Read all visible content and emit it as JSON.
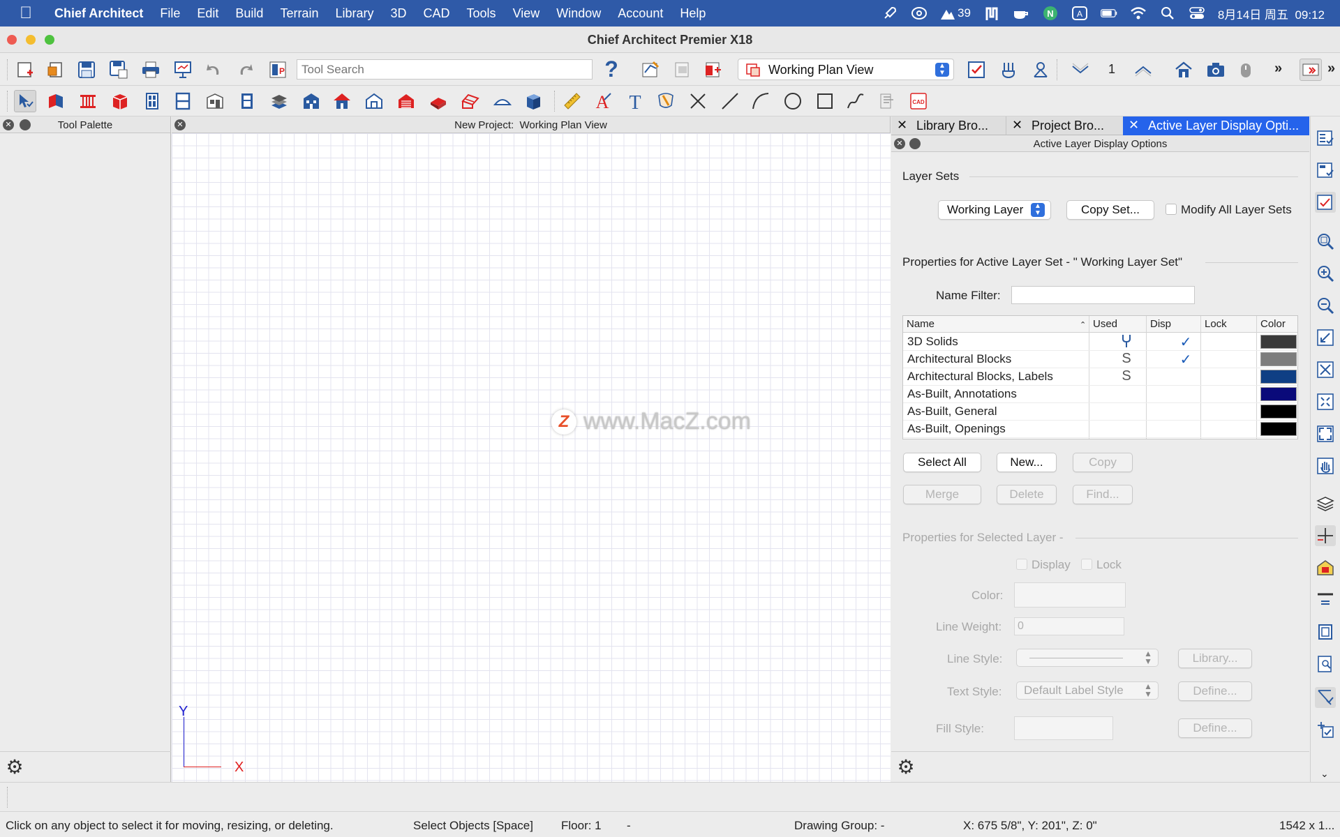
{
  "menubar": {
    "app_name": "Chief Architect",
    "items": [
      "File",
      "Edit",
      "Build",
      "Terrain",
      "Library",
      "3D",
      "CAD",
      "Tools",
      "View",
      "Window",
      "Account",
      "Help"
    ],
    "weather_temp": "39",
    "datetime": "8月14日 周五  09:12"
  },
  "window": {
    "title": "Chief Architect Premier X18"
  },
  "toolbar": {
    "search_placeholder": "Tool Search",
    "view_select": "Working Plan View",
    "floor_number": "1"
  },
  "tool_palette": {
    "title": "Tool Palette"
  },
  "plan_view": {
    "title": "New Project:  Working Plan View",
    "axis_y": "Y",
    "axis_x": "X",
    "watermark": "www.MacZ.com"
  },
  "right_panel": {
    "tabs": [
      "Library Bro...",
      "Project Bro...",
      "Active Layer Display Opti..."
    ],
    "sub_title": "Active Layer Display Options",
    "layer_sets_heading": "Layer Sets",
    "layer_set_select": "Working Layer",
    "copy_set_label": "Copy Set...",
    "modify_all_label": "Modify All Layer Sets",
    "properties_heading": "Properties for Active Layer Set - \" Working Layer Set\"",
    "name_filter_label": "Name Filter:",
    "table_headers": [
      "Name",
      "Used",
      "Disp",
      "Lock",
      "Color"
    ],
    "rows": [
      {
        "name": "3D Solids",
        "used": "wrench",
        "disp": "✓",
        "color": "#3a3a3a"
      },
      {
        "name": "Architectural Blocks",
        "used": "S",
        "disp": "✓",
        "color": "#7d7d7d"
      },
      {
        "name": "Architectural Blocks, Labels",
        "used": "S",
        "disp": "",
        "color": "#0f3f84"
      },
      {
        "name": "As-Built, Annotations",
        "used": "",
        "disp": "",
        "color": "#0a0a7a"
      },
      {
        "name": "As-Built, General",
        "used": "",
        "disp": "",
        "color": "#000000"
      },
      {
        "name": "As-Built, Openings",
        "used": "",
        "disp": "",
        "color": "#000000"
      }
    ],
    "buttons": {
      "select_all": "Select All",
      "new": "New...",
      "copy": "Copy",
      "merge": "Merge",
      "delete": "Delete",
      "find": "Find..."
    },
    "selected_layer_heading": "Properties for Selected Layer -",
    "display_label": "Display",
    "lock_label": "Lock",
    "color_label": "Color:",
    "line_weight_label": "Line Weight:",
    "line_weight_value": "0",
    "line_style_label": "Line Style:",
    "library_button": "Library...",
    "text_style_label": "Text Style:",
    "text_style_value": "Default Label Style",
    "define_button": "Define...",
    "fill_style_label": "Fill Style:",
    "define_button_2": "Define..."
  },
  "statusbar": {
    "message": "Click on any object to select it for moving, resizing, or deleting.",
    "mode": "Select Objects [Space]",
    "floor": "Floor: 1",
    "dash": "-",
    "drawing_group": "Drawing Group: -",
    "coords": "X: 675 5/8\", Y: 201\", Z: 0\"",
    "size": "1542 x 1..."
  },
  "colors": {
    "menubar": "#2f5aa8",
    "active_tab": "#2563eb",
    "axis_x": "#e02020",
    "axis_y": "#2020d0"
  }
}
